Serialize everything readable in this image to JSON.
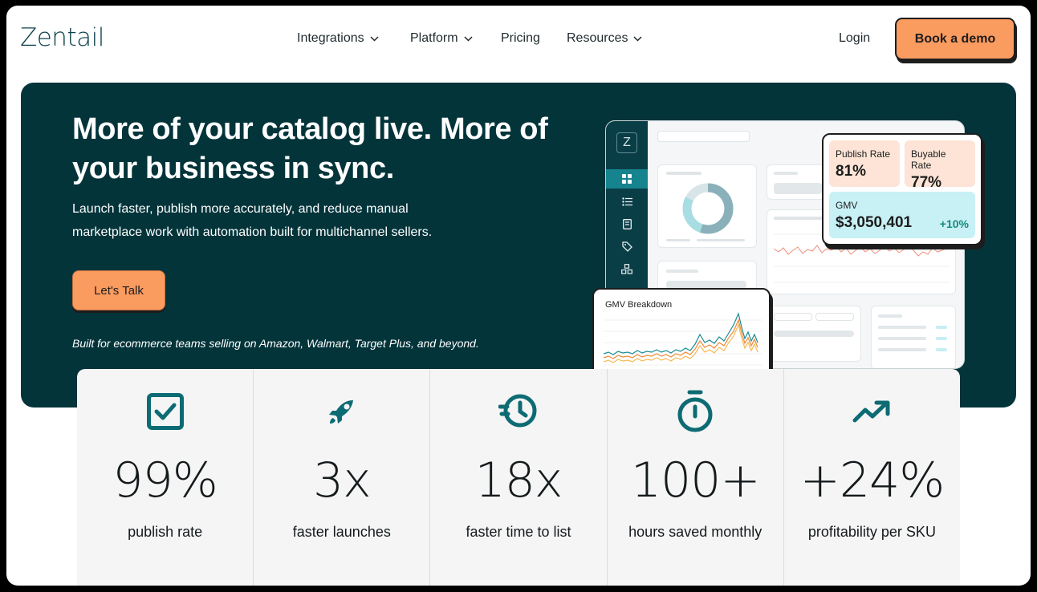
{
  "header": {
    "logo": "Zentail",
    "nav": [
      {
        "label": "Integrations",
        "has_dropdown": true
      },
      {
        "label": "Platform",
        "has_dropdown": true
      },
      {
        "label": "Pricing",
        "has_dropdown": false
      },
      {
        "label": "Resources",
        "has_dropdown": true
      }
    ],
    "login": "Login",
    "cta": "Book a demo"
  },
  "hero": {
    "title": "More of your catalog live. More of your business in sync.",
    "subtitle": "Launch faster, publish more accurately, and reduce manual marketplace work with automation built for multichannel sellers.",
    "cta": "Let's Talk",
    "note": "Built for ecommerce teams selling on Amazon, Walmart, Target Plus, and beyond."
  },
  "dashboard": {
    "sidebar_logo": "Z",
    "metrics": {
      "publish_rate_label": "Publish Rate",
      "publish_rate_value": "81%",
      "buyable_rate_label": "Buyable Rate",
      "buyable_rate_value": "77%",
      "gmv_label": "GMV",
      "gmv_value": "$3,050,401",
      "gmv_change": "+10%"
    },
    "gmv_breakdown_title": "GMV Breakdown"
  },
  "stats": [
    {
      "icon": "checkbox-icon",
      "value": "99%",
      "label": "publish rate"
    },
    {
      "icon": "rocket-icon",
      "value": "3x",
      "label": "faster launches"
    },
    {
      "icon": "history-clock-icon",
      "value": "18x",
      "label": "faster time to list"
    },
    {
      "icon": "stopwatch-icon",
      "value": "100+",
      "label": "hours saved monthly"
    },
    {
      "icon": "trending-up-icon",
      "value": "+24%",
      "label": "profitability per SKU"
    }
  ],
  "colors": {
    "brand_dark": "#02343a",
    "accent_orange": "#fa9b5f",
    "icon_teal": "#0d6b73"
  }
}
